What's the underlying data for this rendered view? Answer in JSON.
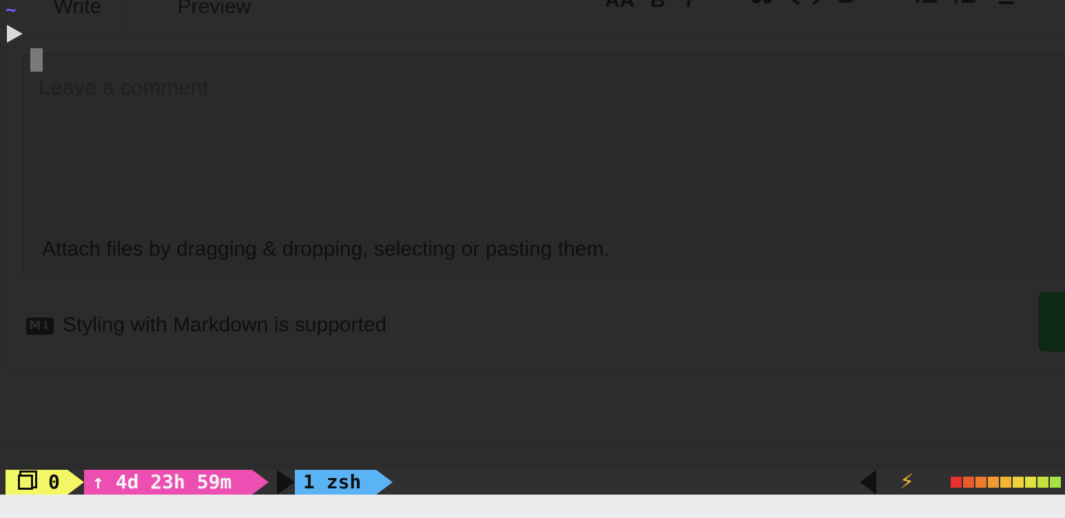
{
  "editor": {
    "tabs": [
      "Write",
      "Preview"
    ],
    "toolbar": [
      "AA",
      "B",
      "I"
    ],
    "placeholder": "Leave a comment",
    "attach_text": "Attach files by dragging & dropping, selecting or pasting them.",
    "markdown_badge": "M↓",
    "markdown_text": "Styling with Markdown is supported"
  },
  "prompt": {
    "tilde": "~"
  },
  "statusbar": {
    "session_count": "0",
    "uptime": "↑ 4d 23h 59m",
    "window": "1 zsh",
    "power_icon": "⚡",
    "battery_cells": [
      "#e8322b",
      "#eb5a2b",
      "#ee7c2c",
      "#f09b2e",
      "#f2b52f",
      "#efd23a",
      "#e3e13f",
      "#c5e140",
      "#a8e043",
      "#8ad845",
      "outline",
      "outline"
    ]
  },
  "colors": {
    "session_bg": "#f3f765",
    "uptime_bg": "#ec4fb1",
    "window_bg": "#5ab3f4",
    "prompt_accent": "#7a5cff"
  }
}
